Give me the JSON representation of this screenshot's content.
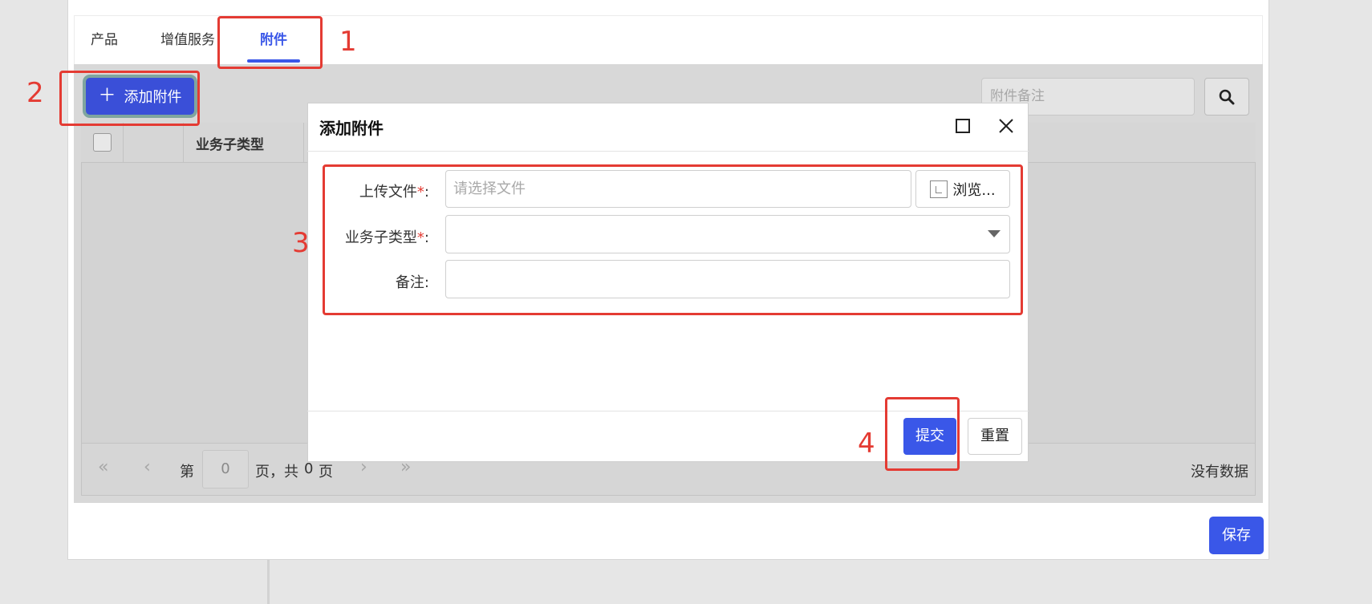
{
  "tabs": [
    {
      "label": "产品"
    },
    {
      "label": "增值服务"
    },
    {
      "label": "附件"
    }
  ],
  "active_tab": "附件",
  "toolbar": {
    "add_label": "添加附件",
    "add_icon": "plus-icon"
  },
  "search": {
    "placeholder": "附件备注",
    "icon": "search-icon"
  },
  "grid": {
    "columns": [
      "",
      "",
      "业务子类型"
    ]
  },
  "pager": {
    "page_prefix": "第",
    "page_value": "0",
    "page_suffix": "页，共",
    "total_pages": "0",
    "total_suffix": "页",
    "status": "没有数据"
  },
  "save_label": "保存",
  "dialog": {
    "title": "添加附件",
    "fields": {
      "upload_label": "上传文件",
      "upload_placeholder": "请选择文件",
      "browse_label": "浏览...",
      "subtype_label": "业务子类型",
      "remark_label": "备注",
      "required_mark": "*",
      "colon": ":"
    },
    "submit_label": "提交",
    "reset_label": "重置"
  },
  "annotations": [
    "1",
    "2",
    "3",
    "4"
  ],
  "colors": {
    "accent": "#3a57e8",
    "annotation": "#e43b33"
  }
}
